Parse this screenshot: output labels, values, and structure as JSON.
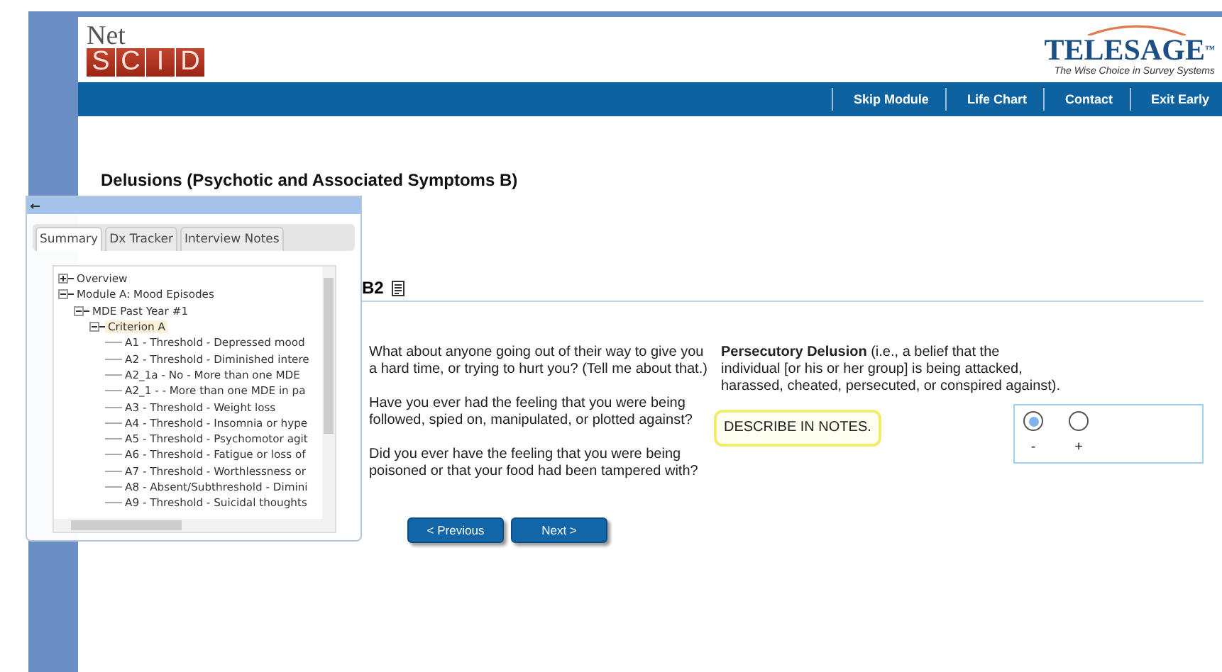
{
  "logo": {
    "top": "Net",
    "letters": [
      "S",
      "C",
      "I",
      "D"
    ]
  },
  "brand": {
    "name": "TELESAGE",
    "tm": "™",
    "tagline": "The Wise Choice in Survey Systems"
  },
  "nav": [
    "Skip Module",
    "Life Chart",
    "Contact",
    "Exit Early"
  ],
  "title": "Delusions (Psychotic and Associated Symptoms B)",
  "panel": {
    "tabs": [
      {
        "label": "Summary",
        "selected": true
      },
      {
        "label": "Dx Tracker",
        "selected": false
      },
      {
        "label": "Interview Notes",
        "selected": false
      }
    ],
    "tree": [
      {
        "label": "Overview",
        "expanded": false,
        "selected": false
      },
      {
        "label": "Module A: Mood Episodes",
        "expanded": true,
        "selected": false,
        "children": [
          {
            "label": "MDE Past Year #1",
            "expanded": true,
            "selected": false,
            "children": [
              {
                "label": "Criterion A",
                "expanded": true,
                "selected": true,
                "children": [
                  {
                    "label": "A1 - Threshold - Depressed mood"
                  },
                  {
                    "label": "A2 - Threshold - Diminished intere"
                  },
                  {
                    "label": "A2_1a - No - More than one MDE"
                  },
                  {
                    "label": "A2_1 - - More than one MDE in pa"
                  },
                  {
                    "label": "A3 - Threshold - Weight loss"
                  },
                  {
                    "label": "A4 - Threshold - Insomnia or hype"
                  },
                  {
                    "label": "A5 - Threshold - Psychomotor agit"
                  },
                  {
                    "label": "A6 - Threshold - Fatigue or loss of"
                  },
                  {
                    "label": "A7 - Threshold - Worthlessness or"
                  },
                  {
                    "label": "A8 - Absent/Subthreshold - Dimini"
                  },
                  {
                    "label": "A9 - Threshold - Suicidal thoughts"
                  }
                ]
              }
            ]
          }
        ]
      }
    ]
  },
  "item": {
    "code": "B2",
    "questions": [
      "What about anyone going out of their way to give you a hard time, or trying to hurt you? (Tell me about that.)",
      "Have you ever had the feeling that you were being followed, spied on, manipulated, or plotted against?",
      "Did you ever have the feeling that you were being poisoned or that your food had been tampered with?"
    ],
    "criterion": "**Persecutory Delusion** (i.e., a belief that the individual [or his or her group] is being attacked, harassed, cheated, persecuted, or conspired against).",
    "note": "DESCRIBE IN NOTES.",
    "options": [
      {
        "label": "-",
        "selected": true
      },
      {
        "label": "+",
        "selected": false
      }
    ]
  },
  "buttons": [
    "< Previous",
    "Next >"
  ]
}
